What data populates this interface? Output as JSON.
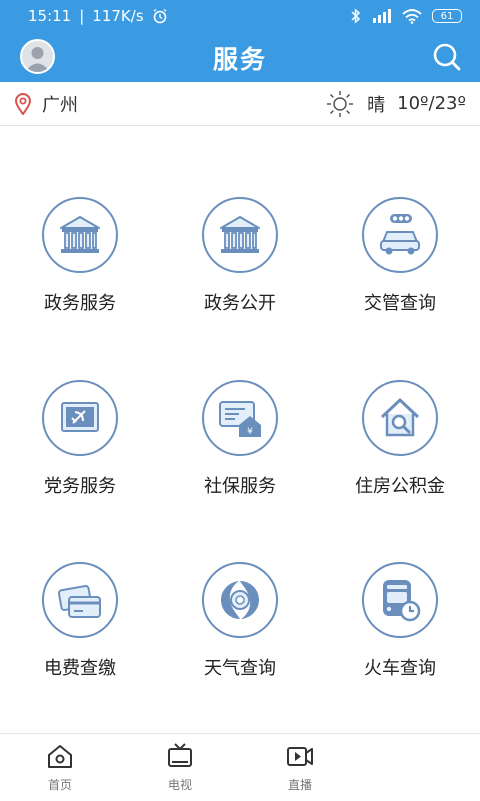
{
  "status_bar": {
    "time": "15:11",
    "speed": "117K/s",
    "battery": "61"
  },
  "header": {
    "title": "服务"
  },
  "location": {
    "city": "广州",
    "weather_text": "晴",
    "temperature": "10º/23º"
  },
  "services": [
    {
      "label": "政务服务",
      "icon": "government-building-icon"
    },
    {
      "label": "政务公开",
      "icon": "government-building-icon"
    },
    {
      "label": "交管查询",
      "icon": "car-traffic-light-icon"
    },
    {
      "label": "党务服务",
      "icon": "party-flag-icon"
    },
    {
      "label": "社保服务",
      "icon": "social-security-card-icon"
    },
    {
      "label": "住房公积金",
      "icon": "house-search-icon"
    },
    {
      "label": "电费查缴",
      "icon": "cards-icon"
    },
    {
      "label": "天气查询",
      "icon": "typhoon-icon"
    },
    {
      "label": "火车查询",
      "icon": "train-clock-icon"
    }
  ],
  "tabs": [
    {
      "label": "首页",
      "icon": "home-icon"
    },
    {
      "label": "电视",
      "icon": "tv-icon"
    },
    {
      "label": "直播",
      "icon": "live-video-icon"
    }
  ],
  "colors": {
    "primary": "#3a9ae2",
    "icon_stroke": "#6a8fbd",
    "icon_fill": "#e3eefb"
  }
}
